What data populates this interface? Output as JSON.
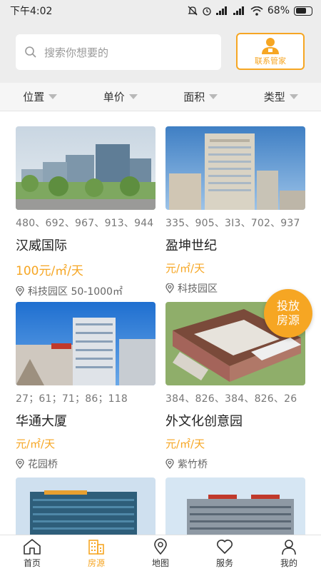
{
  "status_bar": {
    "time": "下午4:02",
    "battery": "68%"
  },
  "search": {
    "placeholder": "搜索你想要的",
    "icon": "search-icon"
  },
  "contact_button": {
    "label": "联系管家",
    "icon": "butler-icon"
  },
  "filters": [
    {
      "label": "位置"
    },
    {
      "label": "单价"
    },
    {
      "label": "面积"
    },
    {
      "label": "类型"
    }
  ],
  "listings": [
    {
      "numbers": "480、692、967、913、944",
      "name": "汉威国际",
      "price": "100元/㎡/天",
      "location": "科技园区 50-1000㎡"
    },
    {
      "numbers": "335、905、3I3、702、937",
      "name": "盈坤世纪",
      "price": "元/㎡/天",
      "location": "科技园区"
    },
    {
      "numbers": "27；61；71；86；118",
      "name": "华通大厦",
      "price": "元/㎡/天",
      "location": "花园桥"
    },
    {
      "numbers": "384、826、384、826、26",
      "name": "外文化创意园",
      "price": "元/㎡/天",
      "location": "紫竹桥"
    }
  ],
  "fab": {
    "line1": "投放",
    "line2": "房源"
  },
  "tabs": [
    {
      "label": "首页",
      "icon": "home-icon"
    },
    {
      "label": "房源",
      "icon": "building-icon",
      "active": true
    },
    {
      "label": "地图",
      "icon": "map-pin-icon"
    },
    {
      "label": "服务",
      "icon": "heart-icon"
    },
    {
      "label": "我的",
      "icon": "person-icon"
    }
  ],
  "colors": {
    "accent": "#f6a623",
    "header_bg": "#ededed"
  }
}
